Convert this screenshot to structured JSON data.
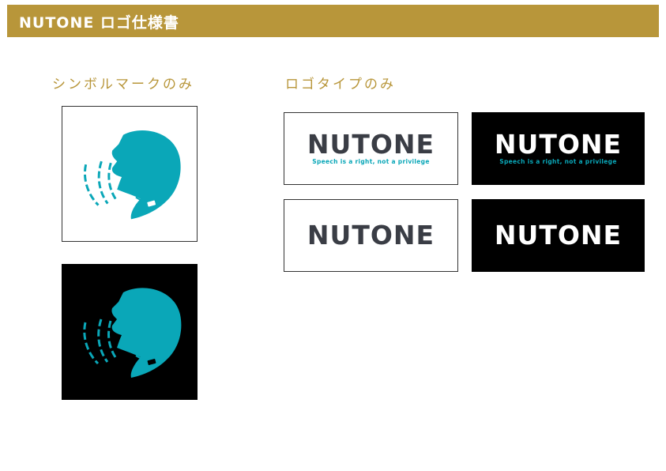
{
  "header": {
    "title": "NUTONE ロゴ仕様書"
  },
  "sections": {
    "symbol": {
      "label": "シンボルマークのみ"
    },
    "logotype": {
      "label": "ロゴタイプのみ"
    }
  },
  "logo": {
    "wordmark": "NUTONE",
    "tagline": "Speech is a right, not a privilege"
  },
  "colors": {
    "header_gold": "#b8963a",
    "brand_teal": "#0aa7b8",
    "dark_text": "#3a3d45",
    "black": "#000000",
    "white": "#ffffff"
  },
  "icons": {
    "symbol_mark": "speaking-head-with-headset-icon"
  }
}
